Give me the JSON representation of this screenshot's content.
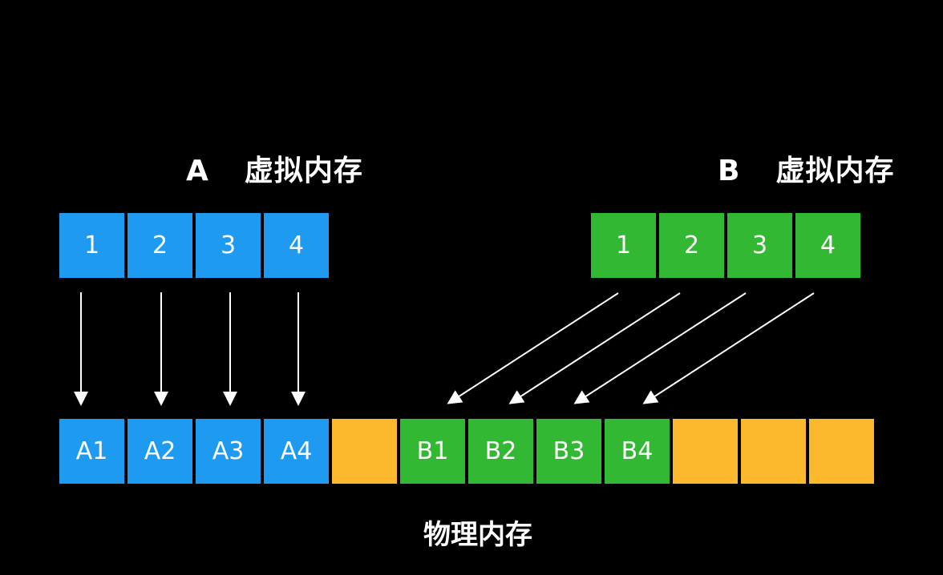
{
  "colors": {
    "background": "#000000",
    "blue": "#1E9BF0",
    "green": "#33B833",
    "orange": "#FDB92E",
    "arrow": "#FFFFFF",
    "text": "#FFFFFF"
  },
  "process_a": {
    "letter": "A",
    "label": "虚拟内存",
    "pages": [
      "1",
      "2",
      "3",
      "4"
    ]
  },
  "process_b": {
    "letter": "B",
    "label": "虚拟内存",
    "pages": [
      "1",
      "2",
      "3",
      "4"
    ]
  },
  "physical_memory": {
    "label": "物理内存",
    "frames": [
      {
        "text": "A1",
        "color": "blue"
      },
      {
        "text": "A2",
        "color": "blue"
      },
      {
        "text": "A3",
        "color": "blue"
      },
      {
        "text": "A4",
        "color": "blue"
      },
      {
        "text": "",
        "color": "orange"
      },
      {
        "text": "B1",
        "color": "green"
      },
      {
        "text": "B2",
        "color": "green"
      },
      {
        "text": "B3",
        "color": "green"
      },
      {
        "text": "B4",
        "color": "green"
      },
      {
        "text": "",
        "color": "orange"
      },
      {
        "text": "",
        "color": "orange"
      },
      {
        "text": "",
        "color": "orange"
      }
    ]
  },
  "mappings": [
    {
      "from": "A.1",
      "to": "A1"
    },
    {
      "from": "A.2",
      "to": "A2"
    },
    {
      "from": "A.3",
      "to": "A3"
    },
    {
      "from": "A.4",
      "to": "A4"
    },
    {
      "from": "B.1",
      "to": "B1"
    },
    {
      "from": "B.2",
      "to": "B2"
    },
    {
      "from": "B.3",
      "to": "B3"
    },
    {
      "from": "B.4",
      "to": "B4"
    }
  ]
}
